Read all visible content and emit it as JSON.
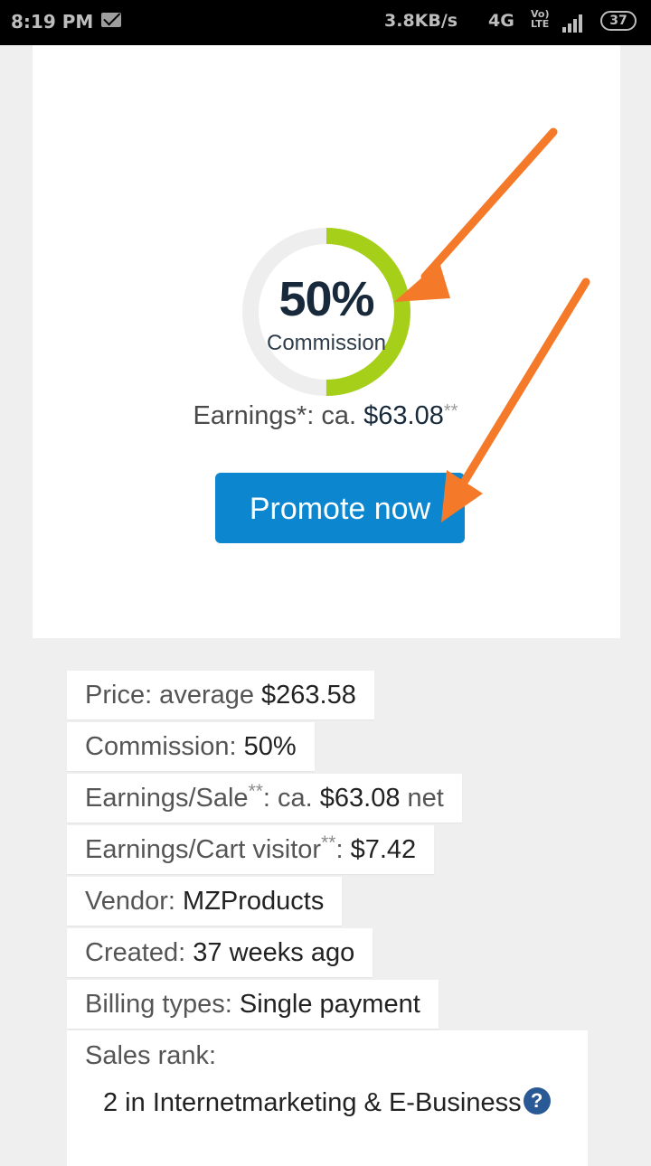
{
  "status_bar": {
    "time": "8:19 PM",
    "speed": "3.8KB/s",
    "network": "4G",
    "volte": "Vo) LTE",
    "battery": "37",
    "icons": [
      "mail-icon",
      "signal-icon",
      "battery-icon"
    ]
  },
  "offer": {
    "commission_percent": "50%",
    "commission_fraction": 0.5,
    "commission_label": "Commission",
    "earnings_prefix": "Earnings*: ca. ",
    "earnings_value": "$63.08",
    "earnings_suffix": "**",
    "promote_label": "Promote now",
    "colors": {
      "gauge": "#a6cf1a",
      "gauge_track": "#eeeeee",
      "button": "#0b86cf",
      "arrow": "#f47a2a"
    }
  },
  "details": {
    "price_label": "Price: average ",
    "price_value": "$263.58",
    "commission_label": "Commission: ",
    "commission_value": "50%",
    "earnings_sale_label": "Earnings/Sale",
    "earnings_sale_sup": "**",
    "earnings_sale_mid": ": ca. ",
    "earnings_sale_value": "$63.08",
    "earnings_sale_suffix": " net",
    "earnings_cart_label": "Earnings/Cart visitor",
    "earnings_cart_sup": "**",
    "earnings_cart_mid": ": ",
    "earnings_cart_value": "$7.42",
    "vendor_label": "Vendor: ",
    "vendor_value": "MZProducts",
    "created_label": "Created: ",
    "created_value": "37 weeks ago",
    "billing_label": "Billing types: ",
    "billing_value": "Single payment",
    "sales_rank_label": "Sales rank:",
    "sales_rank_value": "2 in Internetmarketing & E-Business",
    "help_glyph": "?"
  }
}
